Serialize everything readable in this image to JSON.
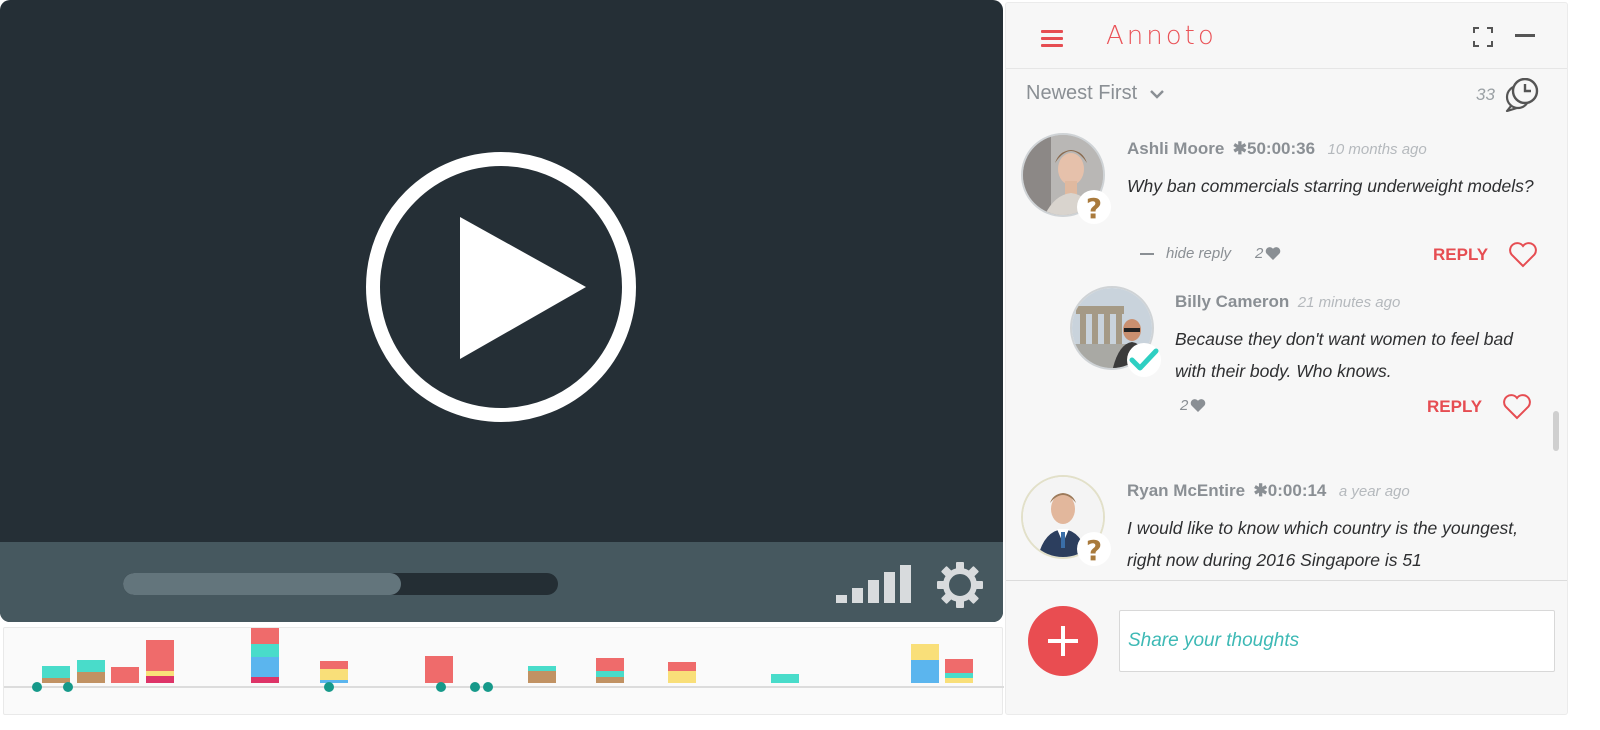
{
  "player": {
    "progress_fraction": 0.64
  },
  "timeline": {
    "colors": {
      "red": "#ef6b6b",
      "teal": "#49dcca",
      "brown": "#c19263",
      "yellow": "#f9df79",
      "blue": "#5bb5ee",
      "magenta": "#de3468",
      "dot": "#16998a",
      "track": "#dcdcdc"
    },
    "bars": [
      {
        "segments": [
          "brown",
          "teal"
        ]
      },
      {
        "segments": [
          "brown",
          "teal"
        ]
      },
      {
        "segments": [
          "red"
        ]
      },
      {
        "segments": [
          "magenta",
          "yellow",
          "red",
          "red"
        ]
      },
      {
        "segments": [
          "magenta",
          "blue",
          "teal",
          "red"
        ]
      },
      {
        "segments": [
          "blue",
          "yellow",
          "red"
        ]
      },
      {
        "segments": [
          "red"
        ]
      },
      {
        "segments": [
          "brown",
          "teal"
        ]
      },
      {
        "segments": [
          "brown",
          "teal",
          "red"
        ]
      },
      {
        "segments": [
          "yellow",
          "red"
        ]
      },
      {
        "segments": [
          "teal"
        ]
      },
      {
        "segments": [
          "blue",
          "yellow"
        ]
      },
      {
        "segments": [
          "yellow",
          "teal",
          "red"
        ]
      }
    ]
  },
  "sidebar": {
    "logo": "Annoto",
    "sort_label": "Newest First",
    "comment_count": "33",
    "icons": {
      "menu": "hamburger-icon",
      "expand": "expand-icon",
      "minimize": "minimize-icon",
      "sort": "chevron-down-icon",
      "count": "comments-clock-icon",
      "like": "heart-icon",
      "add": "plus-icon"
    },
    "comments": [
      {
        "author": "Ashli Moore",
        "timestamp": "✱50:00:36",
        "time_ago": "10 months ago",
        "text": "Why ban commercials starring underweight models?",
        "badge": "question",
        "hide_reply": "hide reply",
        "likes": "2",
        "reply_label": "REPLY",
        "replies": [
          {
            "author": "Billy Cameron",
            "time_ago": "21 minutes ago",
            "text": "Because they don't want women to feel bad with their body. Who knows.",
            "badge": "check",
            "likes": "2",
            "reply_label": "REPLY"
          }
        ]
      },
      {
        "author": "Ryan McEntire",
        "timestamp": "✱0:00:14",
        "time_ago": "a year ago",
        "text": "I would like to know which country is the youngest, right now during 2016 Singapore is 51",
        "badge": "question"
      }
    ],
    "input_placeholder": "Share your thoughts"
  }
}
